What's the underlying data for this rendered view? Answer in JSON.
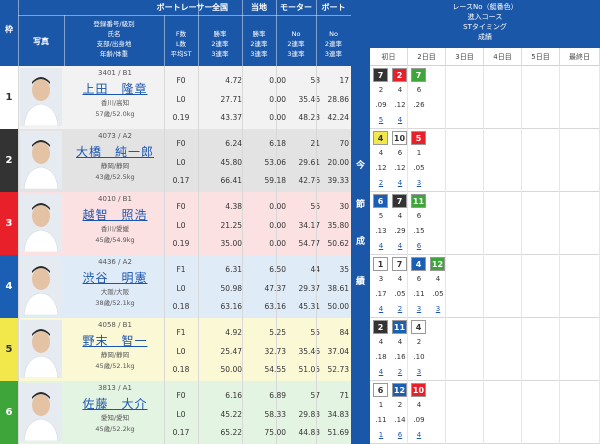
{
  "header": {
    "boatracer": "ボートレーサー",
    "frame": "枠",
    "photo": "写真",
    "reg_info_lines": [
      "登録番号/級別",
      "氏名",
      "支部/出身地",
      "年齢/体重"
    ],
    "national": "全国",
    "local": "当地",
    "motor": "モーター",
    "boat": "ボート",
    "f_count_lines": [
      "F数",
      "L数",
      "平均ST"
    ],
    "national_sub": [
      "勝率",
      "2連率",
      "3連率"
    ],
    "local_sub": [
      "勝率",
      "2連率",
      "3連率"
    ],
    "motor_sub": [
      "No",
      "2連率",
      "3連率"
    ],
    "boat_sub": [
      "No",
      "2連率",
      "3連率"
    ],
    "race_no": "レースNo（艇番色）",
    "course": "進入コース",
    "st_timing": "STタイミング",
    "result": "成績",
    "days": [
      "初日",
      "2日目",
      "3日目",
      "4日目",
      "5日目",
      "最終日"
    ]
  },
  "middle_label": [
    "今",
    "節",
    "成",
    "績"
  ],
  "colors": {
    "header_blue": "#1b57a8",
    "link_blue": "#1a55b0",
    "waku": [
      "#ffffff",
      "#333333",
      "#e8202a",
      "#1a5fb4",
      "#f3e84b",
      "#3da53a"
    ],
    "row_bg": [
      "#f2f2f2",
      "#e3e3e3",
      "#fbe1e1",
      "#e0ebf8",
      "#fbf8d6",
      "#e4f4e2"
    ]
  },
  "racers": [
    {
      "waku": "1",
      "reg": "3401 / B1",
      "name": "上田　隆章",
      "branch": "香川/高知",
      "age_weight": "57歳/52.0kg",
      "f": "F0",
      "l": "L0",
      "st": "0.19",
      "nat": [
        "4.72",
        "27.71",
        "43.37"
      ],
      "loc": [
        "0.00",
        "0.00",
        "0.00"
      ],
      "motor": [
        "58",
        "35.46",
        "48.23"
      ],
      "boat": [
        "17",
        "28.86",
        "42.24"
      ],
      "results": [
        {
          "race": "7",
          "color": "#333333",
          "fg": "#ffffff",
          "course": "2",
          "st": ".09",
          "rank": "5"
        },
        {
          "race": "2",
          "color": "#e8202a",
          "fg": "#ffffff",
          "course": "4",
          "st": ".12",
          "rank": "4"
        },
        {
          "race": "7",
          "color": "#3da53a",
          "fg": "#ffffff",
          "course": "6",
          "st": ".26",
          "rank": ""
        }
      ]
    },
    {
      "waku": "2",
      "reg": "4073 / A2",
      "name": "大橋　純一郎",
      "branch": "静岡/静岡",
      "age_weight": "43歳/52.5kg",
      "f": "F0",
      "l": "L0",
      "st": "0.17",
      "nat": [
        "6.24",
        "45.80",
        "66.41"
      ],
      "loc": [
        "6.18",
        "53.06",
        "59.18"
      ],
      "motor": [
        "21",
        "29.61",
        "42.76"
      ],
      "boat": [
        "70",
        "20.00",
        "39.33"
      ],
      "results": [
        {
          "race": "4",
          "color": "#f3e84b",
          "fg": "#333333",
          "course": "4",
          "st": ".12",
          "rank": "2"
        },
        {
          "race": "10",
          "color": "#ffffff",
          "fg": "#333333",
          "course": "6",
          "st": ".12",
          "rank": "4"
        },
        {
          "race": "5",
          "color": "#e8202a",
          "fg": "#ffffff",
          "course": "1",
          "st": ".05",
          "rank": "3"
        }
      ]
    },
    {
      "waku": "3",
      "reg": "4010 / B1",
      "name": "越智　照浩",
      "branch": "香川/愛媛",
      "age_weight": "45歳/54.9kg",
      "f": "F0",
      "l": "L0",
      "st": "0.19",
      "nat": [
        "4.38",
        "21.25",
        "35.00"
      ],
      "loc": [
        "0.00",
        "0.00",
        "0.00"
      ],
      "motor": [
        "56",
        "34.17",
        "54.77"
      ],
      "boat": [
        "30",
        "35.80",
        "50.62"
      ],
      "results": [
        {
          "race": "6",
          "color": "#1a5fb4",
          "fg": "#ffffff",
          "course": "5",
          "st": ".13",
          "rank": "4"
        },
        {
          "race": "7",
          "color": "#333333",
          "fg": "#ffffff",
          "course": "4",
          "st": ".29",
          "rank": "4"
        },
        {
          "race": "11",
          "color": "#3da53a",
          "fg": "#ffffff",
          "course": "6",
          "st": ".15",
          "rank": "6"
        }
      ]
    },
    {
      "waku": "4",
      "reg": "4436 / A2",
      "name": "渋谷　明憲",
      "branch": "大阪/大阪",
      "age_weight": "38歳/52.1kg",
      "f": "F1",
      "l": "L0",
      "st": "0.18",
      "nat": [
        "6.31",
        "50.98",
        "63.16"
      ],
      "loc": [
        "6.50",
        "47.37",
        "63.16"
      ],
      "motor": [
        "44",
        "29.37",
        "45.31"
      ],
      "boat": [
        "35",
        "38.61",
        "50.00"
      ],
      "results": [
        {
          "race": "1",
          "color": "#ffffff",
          "fg": "#333333",
          "course": "3",
          "st": ".17",
          "rank": "4"
        },
        {
          "race": "7",
          "color": "#ffffff",
          "fg": "#333333",
          "course": "4",
          "st": ".05",
          "rank": "2"
        },
        {
          "race": "4",
          "color": "#1a5fb4",
          "fg": "#ffffff",
          "course": "6",
          "st": ".11",
          "rank": "3"
        },
        {
          "race": "12",
          "color": "#3da53a",
          "fg": "#ffffff",
          "course": "4",
          "st": ".05",
          "rank": "3"
        }
      ]
    },
    {
      "waku": "5",
      "reg": "4058 / B1",
      "name": "野末　智一",
      "branch": "静岡/静岡",
      "age_weight": "45歳/52.1kg",
      "f": "F1",
      "l": "L0",
      "st": "0.18",
      "nat": [
        "4.92",
        "25.47",
        "50.00"
      ],
      "loc": [
        "5.25",
        "32.73",
        "54.55"
      ],
      "motor": [
        "55",
        "35.46",
        "51.05"
      ],
      "boat": [
        "84",
        "37.04",
        "52.73"
      ],
      "results": [
        {
          "race": "2",
          "color": "#333333",
          "fg": "#ffffff",
          "course": "4",
          "st": ".18",
          "rank": "4"
        },
        {
          "race": "11",
          "color": "#1a5fb4",
          "fg": "#ffffff",
          "course": "4",
          "st": ".16",
          "rank": "2"
        },
        {
          "race": "4",
          "color": "#ffffff",
          "fg": "#333333",
          "course": "2",
          "st": ".10",
          "rank": "3"
        }
      ]
    },
    {
      "waku": "6",
      "reg": "3813 / A1",
      "name": "佐藤　大介",
      "branch": "愛知/愛知",
      "age_weight": "45歳/52.2kg",
      "f": "F0",
      "l": "L0",
      "st": "0.17",
      "nat": [
        "6.16",
        "45.22",
        "65.22"
      ],
      "loc": [
        "6.89",
        "58.33",
        "75.00"
      ],
      "motor": [
        "57",
        "29.83",
        "44.83"
      ],
      "boat": [
        "71",
        "34.83",
        "51.69"
      ],
      "results": [
        {
          "race": "6",
          "color": "#ffffff",
          "fg": "#333333",
          "course": "1",
          "st": ".11",
          "rank": "1"
        },
        {
          "race": "12",
          "color": "#1a5fb4",
          "fg": "#ffffff",
          "course": "2",
          "st": ".14",
          "rank": "6"
        },
        {
          "race": "10",
          "color": "#e8202a",
          "fg": "#ffffff",
          "course": "4",
          "st": ".09",
          "rank": "4"
        }
      ]
    }
  ]
}
